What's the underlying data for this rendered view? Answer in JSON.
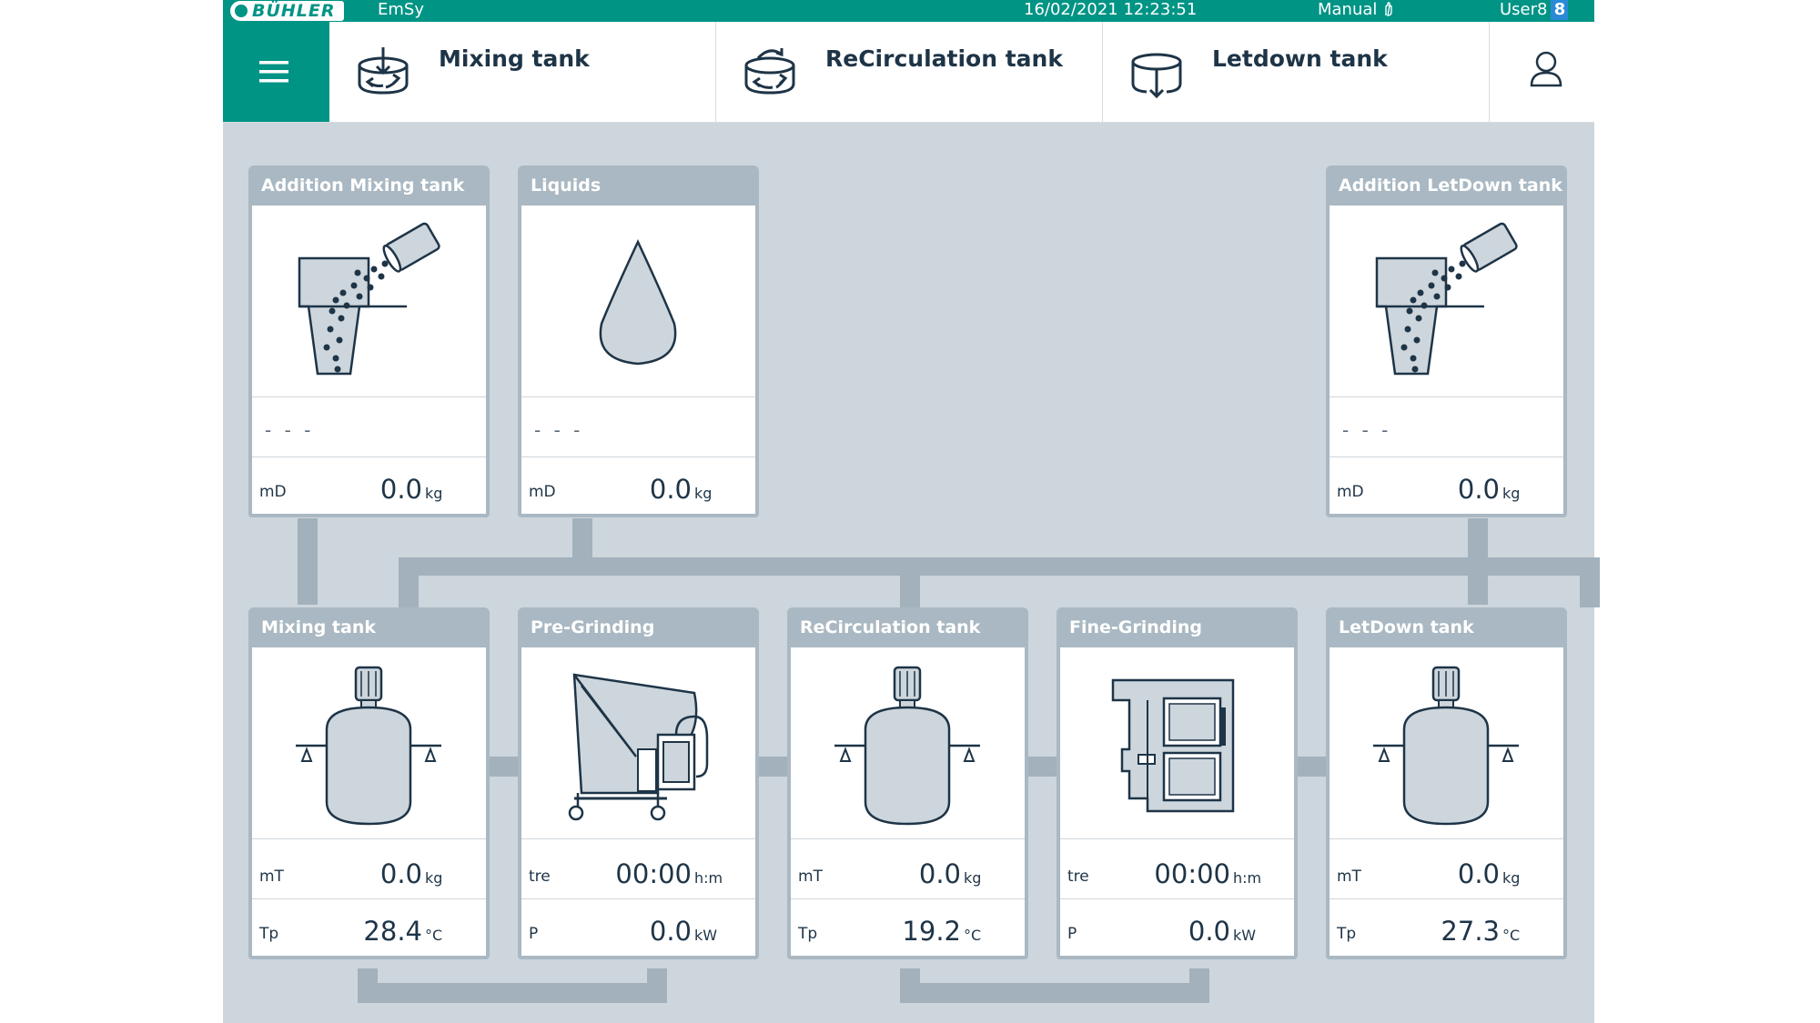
{
  "status": {
    "brand": "BÜHLER",
    "app": "EmSy",
    "datetime": "16/02/2021 12:23:51",
    "mode": "Manual",
    "user": "User8",
    "user_level": "8"
  },
  "nav": {
    "tabs": [
      {
        "label": "Mixing tank",
        "icon": "mixing-tank-icon"
      },
      {
        "label": "ReCirculation tank",
        "icon": "recirculation-icon"
      },
      {
        "label": "Letdown tank",
        "icon": "letdown-icon"
      }
    ]
  },
  "colors": {
    "accent": "#009485",
    "panel_header": "#a9b8c2",
    "background": "#cdd6dc",
    "text": "#1e3447"
  },
  "panels": {
    "addition_mixing": {
      "title": "Addition Mixing tank",
      "status": "- - -",
      "label": "mD",
      "value": "0.0",
      "unit": "kg"
    },
    "liquids": {
      "title": "Liquids",
      "status": "- - -",
      "label": "mD",
      "value": "0.0",
      "unit": "kg"
    },
    "addition_letdown": {
      "title": "Addition LetDown tank",
      "status": "- - -",
      "label": "mD",
      "value": "0.0",
      "unit": "kg"
    },
    "mixing_tank": {
      "title": "Mixing tank",
      "r1": {
        "label": "mT",
        "value": "0.0",
        "unit": "kg"
      },
      "r2": {
        "label": "Tp",
        "value": "28.4",
        "unit": "°C"
      }
    },
    "pre_grinding": {
      "title": "Pre-Grinding",
      "r1": {
        "label": "tre",
        "value": "00:00",
        "unit": "h:m"
      },
      "r2": {
        "label": "P",
        "value": "0.0",
        "unit": "kW"
      }
    },
    "recirculation_tank": {
      "title": "ReCirculation tank",
      "r1": {
        "label": "mT",
        "value": "0.0",
        "unit": "kg"
      },
      "r2": {
        "label": "Tp",
        "value": "19.2",
        "unit": "°C"
      }
    },
    "fine_grinding": {
      "title": "Fine-Grinding",
      "r1": {
        "label": "tre",
        "value": "00:00",
        "unit": "h:m"
      },
      "r2": {
        "label": "P",
        "value": "0.0",
        "unit": "kW"
      }
    },
    "letdown_tank": {
      "title": "LetDown tank",
      "r1": {
        "label": "mT",
        "value": "0.0",
        "unit": "kg"
      },
      "r2": {
        "label": "Tp",
        "value": "27.3",
        "unit": "°C"
      }
    }
  }
}
